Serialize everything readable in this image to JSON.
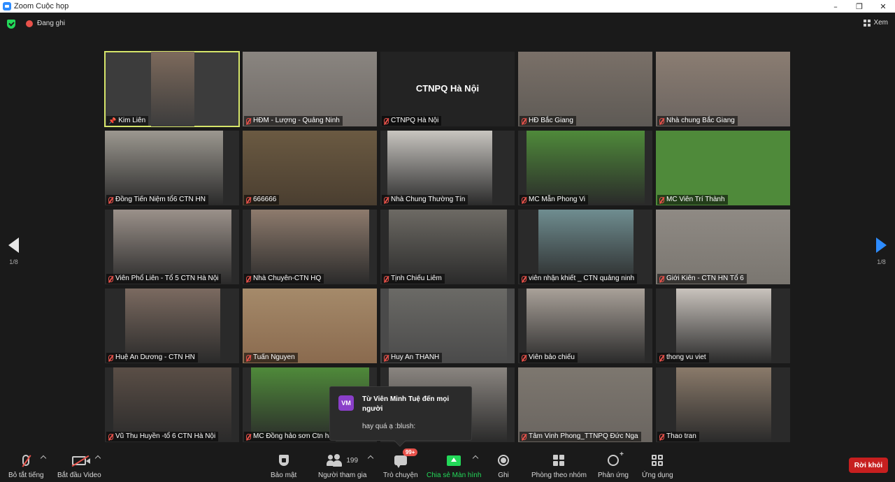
{
  "window": {
    "title": "Zoom Cuộc họp",
    "controls": {
      "minimize": "–",
      "restore": "❐",
      "close": "✕"
    }
  },
  "status": {
    "recording_label": "Đang ghi",
    "view_label": "Xem"
  },
  "pagination": {
    "left": "1/8",
    "right": "1/8"
  },
  "tiles": [
    {
      "name": "Kim Liên",
      "muted": false,
      "pinned": true,
      "active": true,
      "bg": "#3c3c3c",
      "feed_color": "#7d6a5c"
    },
    {
      "name": "HĐM - Lượng - Quảng Ninh",
      "muted": true,
      "bg": "#6f6a66",
      "feed_color": "#8a8580"
    },
    {
      "name": "CTNPQ Hà Nội",
      "muted": true,
      "bg": "#232323",
      "feed_color": "#232323",
      "center_text": "CTNPQ Hà Nội"
    },
    {
      "name": "HĐ Bắc Giang",
      "muted": true,
      "bg": "#5e5a55",
      "feed_color": "#7a7068"
    },
    {
      "name": "Nhà chung Bắc Giang",
      "muted": true,
      "bg": "#6b6460",
      "feed_color": "#8b7d72"
    },
    {
      "name": "Đồng Tiến Niệm tổ6 CTN HN",
      "muted": true,
      "bg": "#2a2a2a",
      "feed_color": "#9c9890"
    },
    {
      "name": "666666",
      "muted": true,
      "bg": "#4a3e30",
      "feed_color": "#6b5a42"
    },
    {
      "name": "Nhà Chung Thường Tín",
      "muted": true,
      "bg": "#2a2a2a",
      "feed_color": "#c8c5c0"
    },
    {
      "name": "MC Mẫn Phong Vi",
      "muted": true,
      "bg": "#2a2a2a",
      "feed_color": "#4f8a3a"
    },
    {
      "name": "MC Viên Trí Thành",
      "muted": true,
      "bg": "#4f8a3a",
      "feed_color": "#4f8a3a"
    },
    {
      "name": "Viên Phổ Liên - Tổ 5 CTN Hà Nội",
      "muted": true,
      "bg": "#2a2a2a",
      "feed_color": "#9b918a"
    },
    {
      "name": "Nhà Chuyên-CTN HQ",
      "muted": true,
      "bg": "#2a2a2a",
      "feed_color": "#8e7b6d"
    },
    {
      "name": "Tịnh Chiếu Liêm",
      "muted": true,
      "bg": "#2a2a2a",
      "feed_color": "#6d6a64"
    },
    {
      "name": "viên nhận khiết _ CTN quảng ninh",
      "muted": true,
      "bg": "#2a2a2a",
      "feed_color": "#6f8d90"
    },
    {
      "name": "Giới Kiên - CTN HN Tổ 6",
      "muted": true,
      "bg": "#7a7670",
      "feed_color": "#8f8a84"
    },
    {
      "name": "Huệ An Dương - CTN HN",
      "muted": true,
      "bg": "#2a2a2a",
      "feed_color": "#7b6a60"
    },
    {
      "name": "Tuấn Nguyen",
      "muted": true,
      "bg": "#8a6a4e",
      "feed_color": "#a58a6a"
    },
    {
      "name": "Huy An THANH",
      "muted": true,
      "bg": "#4a4a4a",
      "feed_color": "#6b6a66"
    },
    {
      "name": "Viên bảo chiếu",
      "muted": true,
      "bg": "#2a2a2a",
      "feed_color": "#a9a199"
    },
    {
      "name": "thong vu viet",
      "muted": true,
      "bg": "#2a2a2a",
      "feed_color": "#c9c3bd"
    },
    {
      "name": "Vũ Thu Huyền -tổ 6 CTN Hà Nội",
      "muted": true,
      "bg": "#2a2a2a",
      "feed_color": "#5a4e46"
    },
    {
      "name": "MC Đồng hảo sơn Ctn hà",
      "muted": true,
      "bg": "#2a2a2a",
      "feed_color": "#4f8a3a"
    },
    {
      "name": "",
      "muted": false,
      "bg": "#2a2a2a",
      "feed_color": "#8a8580"
    },
    {
      "name": "Tâm Vinh Phong_TTNPQ Đức Nga",
      "muted": true,
      "bg": "#6a6560",
      "feed_color": "#7d776f"
    },
    {
      "name": "Thao tran",
      "muted": true,
      "bg": "#2a2a2a",
      "feed_color": "#8a7a6a"
    }
  ],
  "chat_popup": {
    "avatar_initials": "VM",
    "sender": "Từ Viên Minh Tuệ đến mọi người",
    "message": "hay quá ạ :blush:"
  },
  "toolbar": {
    "mute_label": "Bỏ tắt tiếng",
    "video_label": "Bắt đầu Video",
    "security_label": "Bảo mật",
    "participants_label": "Người tham gia",
    "participants_count": "199",
    "chat_label": "Trò chuyện",
    "chat_badge": "99+",
    "share_label": "Chia sẻ Màn hình",
    "record_label": "Ghi",
    "breakout_label": "Phòng theo nhóm",
    "reactions_label": "Phản ứng",
    "apps_label": "Ứng dụng",
    "leave_label": "Rời khỏi"
  },
  "colors": {
    "accent_blue": "#2d8cff",
    "share_green": "#23d959",
    "leave_red": "#c71f1f",
    "active_speaker_border": "#d6e56a",
    "muted_red": "#e8514a"
  }
}
